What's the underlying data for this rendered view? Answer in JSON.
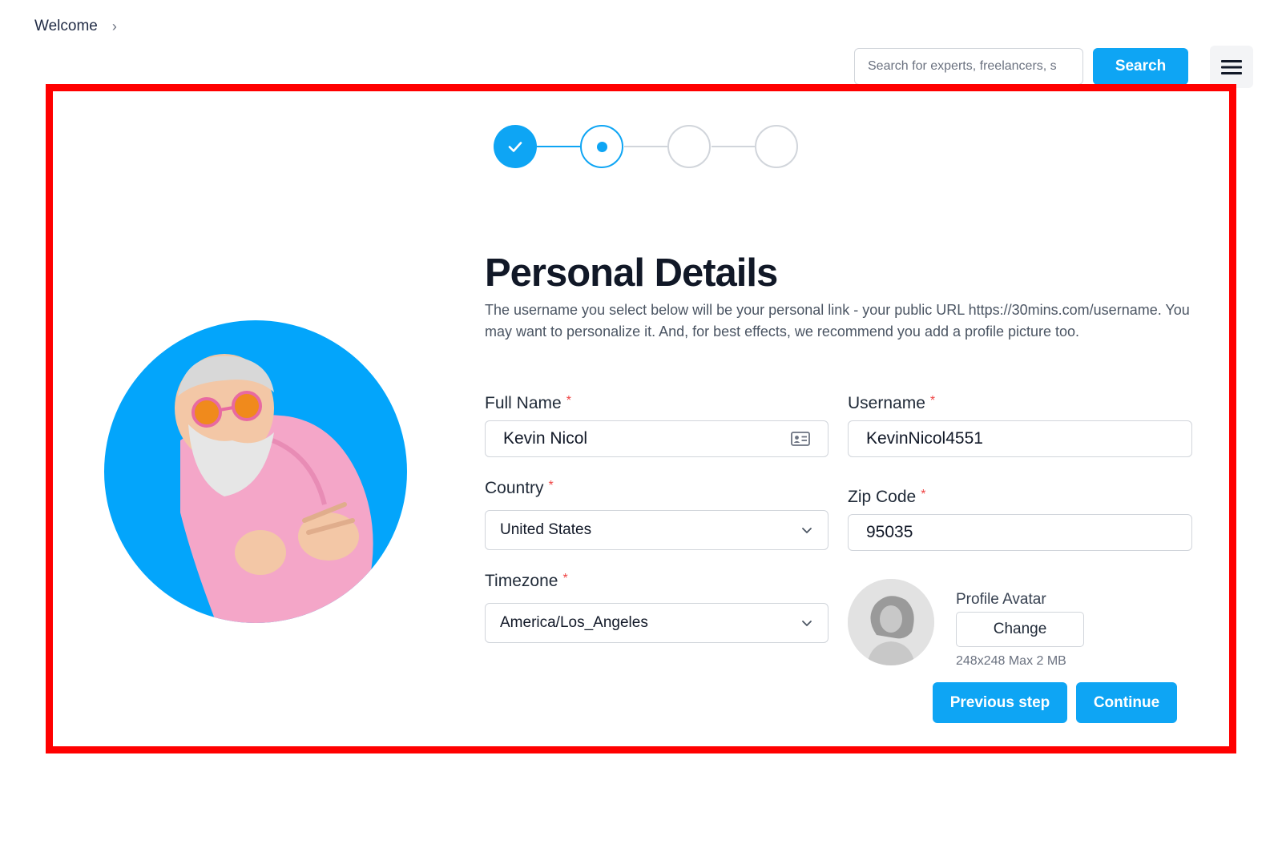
{
  "breadcrumb": {
    "item": "Welcome",
    "separator": "›"
  },
  "header": {
    "search_placeholder": "Search for experts, freelancers, s",
    "search_label": "Search"
  },
  "stepper": {
    "steps": [
      {
        "state": "complete"
      },
      {
        "state": "active"
      },
      {
        "state": "pending"
      },
      {
        "state": "pending"
      }
    ],
    "accent_color": "#0ea5f4"
  },
  "form": {
    "title": "Personal Details",
    "description": "The username you select below will be your personal link - your public URL https://30mins.com/username. You may want to personalize it. And, for best effects, we recommend you add a profile picture too.",
    "required_mark": "*",
    "full_name": {
      "label": "Full Name",
      "value": "Kevin Nicol"
    },
    "username": {
      "label": "Username",
      "value": "KevinNicol4551"
    },
    "country": {
      "label": "Country",
      "value": "United States"
    },
    "zip_code": {
      "label": "Zip Code",
      "value": "95035"
    },
    "timezone": {
      "label": "Timezone",
      "value": "America/Los_Angeles"
    },
    "avatar": {
      "label": "Profile Avatar",
      "change_label": "Change",
      "hint": "248x248  Max 2 MB"
    },
    "previous_label": "Previous step",
    "continue_label": "Continue"
  },
  "icons": {
    "chevron": "chevron-right-icon",
    "menu": "hamburger-menu-icon",
    "contact": "contact-card-icon",
    "check": "check-icon"
  }
}
